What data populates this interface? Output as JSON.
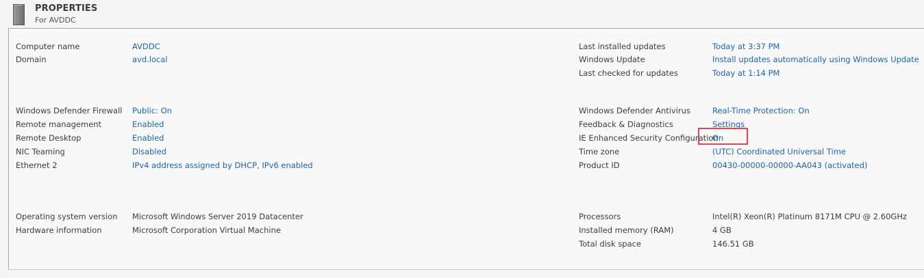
{
  "header": {
    "icon": "server-icon",
    "title": "PROPERTIES",
    "subtitle": "For AVDDC"
  },
  "left_groups": [
    {
      "rows": [
        {
          "label": "Computer name",
          "value": "AVDDC",
          "link": true
        },
        {
          "label": "Domain",
          "value": "avd.local",
          "link": true
        }
      ]
    },
    {
      "rows": [
        {
          "label": "Windows Defender Firewall",
          "value": "Public: On",
          "link": true
        },
        {
          "label": "Remote management",
          "value": "Enabled",
          "link": true
        },
        {
          "label": "Remote Desktop",
          "value": "Enabled",
          "link": true
        },
        {
          "label": "NIC Teaming",
          "value": "Disabled",
          "link": true
        },
        {
          "label": "Ethernet 2",
          "value": "IPv4 address assigned by DHCP, IPv6 enabled",
          "link": true
        }
      ]
    },
    {
      "rows": [
        {
          "label": "Operating system version",
          "value": "Microsoft Windows Server 2019 Datacenter",
          "link": false
        },
        {
          "label": "Hardware information",
          "value": "Microsoft Corporation Virtual Machine",
          "link": false
        }
      ]
    }
  ],
  "right_groups": [
    {
      "rows": [
        {
          "label": "Last installed updates",
          "value": "Today at 3:37 PM",
          "link": true
        },
        {
          "label": "Windows Update",
          "value": "Install updates automatically using Windows Update",
          "link": true
        },
        {
          "label": "Last checked for updates",
          "value": "Today at 1:14 PM",
          "link": true
        }
      ]
    },
    {
      "rows": [
        {
          "label": "Windows Defender Antivirus",
          "value": "Real-Time Protection: On",
          "link": true
        },
        {
          "label": "Feedback & Diagnostics",
          "value": "Settings",
          "link": true
        },
        {
          "label": "IE Enhanced Security Configuration",
          "value": "On",
          "link": true
        },
        {
          "label": "Time zone",
          "value": "(UTC) Coordinated Universal Time",
          "link": true
        },
        {
          "label": "Product ID",
          "value": "00430-00000-00000-AA043 (activated)",
          "link": true
        }
      ]
    },
    {
      "rows": [
        {
          "label": "Processors",
          "value": "Intel(R) Xeon(R) Platinum 8171M CPU @ 2.60GHz",
          "link": false
        },
        {
          "label": "Installed memory (RAM)",
          "value": "4 GB",
          "link": false
        },
        {
          "label": "Total disk space",
          "value": "146.51 GB",
          "link": false
        }
      ]
    }
  ],
  "colors": {
    "link": "#1e63b0",
    "label": "#3c3c3c",
    "highlight_box": "#e0474c"
  }
}
